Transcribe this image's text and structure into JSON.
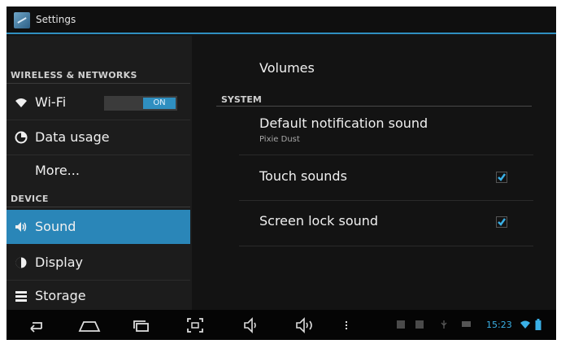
{
  "window": {
    "title": "Settings"
  },
  "left_pane": {
    "wireless_header": "WIRELESS & NETWORKS",
    "wifi": {
      "label": "Wi-Fi",
      "toggle": "ON"
    },
    "data_usage": {
      "label": "Data usage"
    },
    "more": {
      "label": "More..."
    },
    "device_header": "DEVICE",
    "sound": {
      "label": "Sound"
    },
    "display": {
      "label": "Display"
    },
    "storage": {
      "label": "Storage"
    }
  },
  "right_pane": {
    "volumes": "Volumes",
    "system_header": "SYSTEM",
    "default_notification": {
      "label": "Default notification sound",
      "value": "Pixie Dust"
    },
    "touch_sounds": {
      "label": "Touch sounds",
      "checked": true
    },
    "screen_lock_sound": {
      "label": "Screen lock sound",
      "checked": true
    }
  },
  "status_bar": {
    "time": "15:23"
  },
  "colors": {
    "accent": "#2f8fc0",
    "selected": "#2a86b8",
    "time": "#3ab0e6"
  },
  "icons": [
    "back-icon",
    "home-icon",
    "recent-apps-icon",
    "screenshot-icon",
    "volume-down-icon",
    "volume-up-icon",
    "menu-icon",
    "wifi-icon",
    "battery-icon"
  ]
}
